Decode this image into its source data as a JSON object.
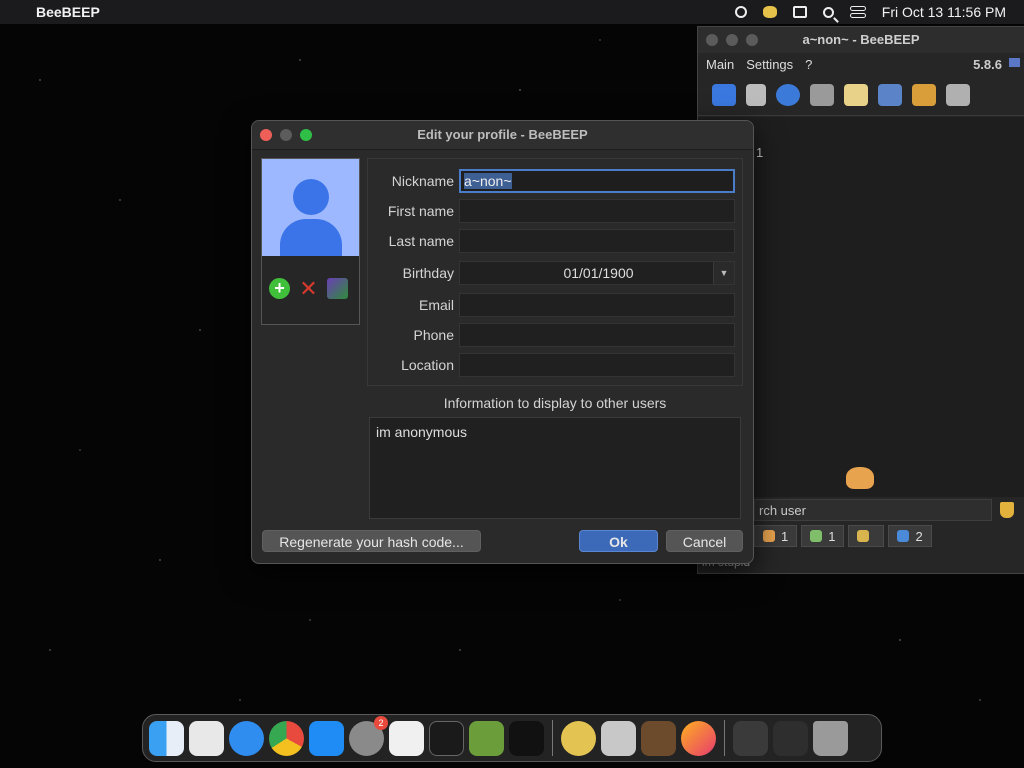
{
  "menubar": {
    "app_name": "BeeBEEP",
    "clock": "Fri Oct 13  11:56 PM",
    "icons": [
      "apple-icon",
      "circle-status-icon",
      "beebeep-icon",
      "window-icon",
      "search-icon",
      "control-center-icon"
    ]
  },
  "main_window": {
    "title": "a~non~ - BeeBEEP",
    "menu": [
      "Main",
      "Settings",
      "?"
    ],
    "version": "5.8.6",
    "user_count": "1",
    "search_placeholder": "rch user",
    "tabs": [
      {
        "label": "1",
        "icon": "users-icon"
      },
      {
        "label": "1",
        "icon": "chat-icon"
      },
      {
        "label": "",
        "icon": "groups-icon"
      },
      {
        "label": "2",
        "icon": "files-icon"
      }
    ],
    "status": "im stupid"
  },
  "dialog": {
    "title": "Edit your profile - BeeBEEP",
    "labels": {
      "nickname": "Nickname",
      "first_name": "First name",
      "last_name": "Last name",
      "birthday": "Birthday",
      "email": "Email",
      "phone": "Phone",
      "location": "Location"
    },
    "values": {
      "nickname": "a~non~",
      "first_name": "",
      "last_name": "",
      "birthday": "01/01/1900",
      "email": "",
      "phone": "",
      "location": ""
    },
    "info_label": "Information to display to other users",
    "info_text": "im anonymous",
    "buttons": {
      "regenerate": "Regenerate your hash code...",
      "ok": "Ok",
      "cancel": "Cancel"
    }
  },
  "dock": {
    "apps": [
      "Finder",
      "Launchpad",
      "Safari",
      "Chrome",
      "App Store",
      "System Settings",
      "TextEdit",
      "Terminal",
      "Minecraft",
      "ChatGPT",
      "BeeBEEP",
      "Settings",
      "Instruments",
      "Firefox",
      "Window 1",
      "Window 2",
      "Trash"
    ],
    "settings_badge": "2"
  }
}
